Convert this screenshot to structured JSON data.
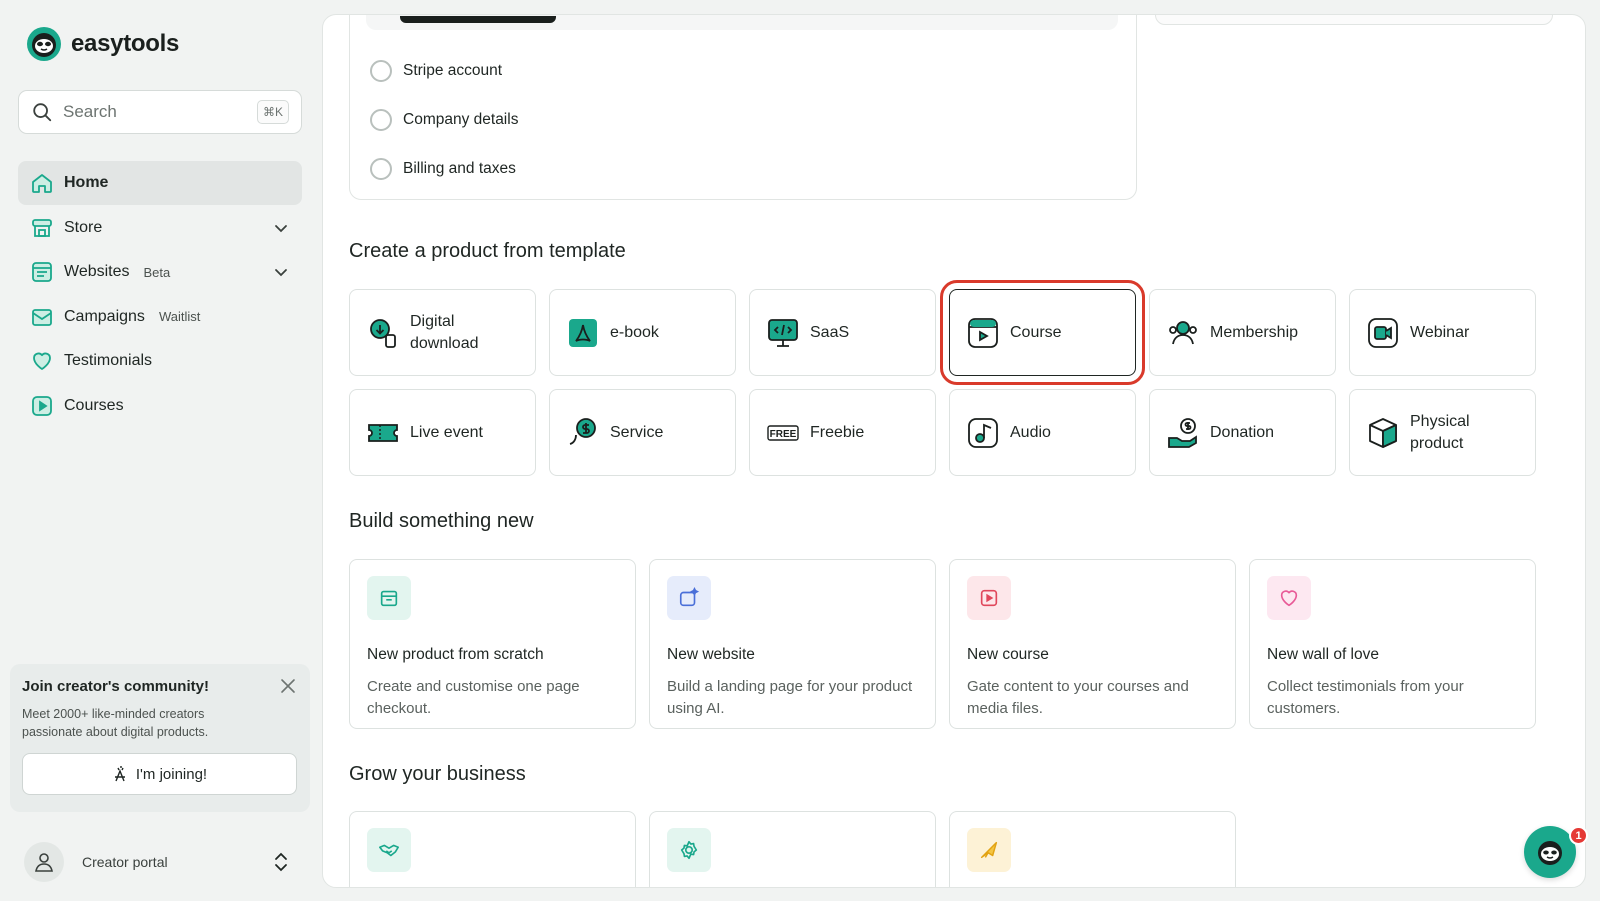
{
  "brand": {
    "name": "easytools"
  },
  "search": {
    "placeholder": "Search",
    "shortcut": "⌘K"
  },
  "sidebar": {
    "items": [
      {
        "label": "Home",
        "icon": "home-icon",
        "active": true
      },
      {
        "label": "Store",
        "icon": "store-icon",
        "expandable": true
      },
      {
        "label": "Websites",
        "tag": "Beta",
        "icon": "websites-icon",
        "expandable": true
      },
      {
        "label": "Campaigns",
        "tag": "Waitlist",
        "icon": "campaigns-icon"
      },
      {
        "label": "Testimonials",
        "icon": "heart-icon"
      },
      {
        "label": "Courses",
        "icon": "play-icon"
      }
    ]
  },
  "community": {
    "title": "Join creator's community!",
    "description": "Meet 2000+ like-minded creators passionate about digital products.",
    "button": "I'm joining!"
  },
  "portal": {
    "label": "Creator portal"
  },
  "checklist": {
    "items": [
      {
        "label": "Stripe account"
      },
      {
        "label": "Company details"
      },
      {
        "label": "Billing and taxes"
      }
    ]
  },
  "templates": {
    "title": "Create a product from template",
    "items": [
      {
        "label": "Digital download",
        "icon": "digital-download-icon"
      },
      {
        "label": "e-book",
        "icon": "ebook-icon"
      },
      {
        "label": "SaaS",
        "icon": "saas-icon"
      },
      {
        "label": "Course",
        "icon": "course-icon",
        "highlighted": true
      },
      {
        "label": "Membership",
        "icon": "membership-icon"
      },
      {
        "label": "Webinar",
        "icon": "webinar-icon"
      },
      {
        "label": "Live event",
        "icon": "ticket-icon"
      },
      {
        "label": "Service",
        "icon": "service-icon"
      },
      {
        "label": "Freebie",
        "icon": "free-icon"
      },
      {
        "label": "Audio",
        "icon": "audio-icon"
      },
      {
        "label": "Donation",
        "icon": "donation-icon"
      },
      {
        "label": "Physical product",
        "icon": "box-icon"
      }
    ]
  },
  "build": {
    "title": "Build something new",
    "items": [
      {
        "title": "New product from scratch",
        "description": "Create and customise one page checkout.",
        "icon": "store-icon",
        "bg": "#e3f5ef",
        "color": "#1aa88c"
      },
      {
        "title": "New website",
        "description": "Build a landing page for your product using AI.",
        "icon": "sparkle-window-icon",
        "bg": "#e6ecfb",
        "color": "#4a6fd8"
      },
      {
        "title": "New course",
        "description": "Gate content to your courses and media files.",
        "icon": "play-icon",
        "bg": "#fde7ea",
        "color": "#e0475b"
      },
      {
        "title": "New wall of love",
        "description": "Collect testimonials from your customers.",
        "icon": "heart-icon",
        "bg": "#fde8f1",
        "color": "#e85a97"
      }
    ]
  },
  "grow": {
    "title": "Grow your business",
    "items": [
      {
        "icon": "handshake-icon",
        "bg": "#e3f5ef",
        "color": "#1aa88c"
      },
      {
        "icon": "gear-icon",
        "bg": "#e3f5ef",
        "color": "#1aa88c"
      },
      {
        "icon": "send-icon",
        "bg": "#fdf2d6",
        "color": "#e2a313"
      }
    ]
  },
  "chat": {
    "badge": "1"
  },
  "colors": {
    "accent": "#1aa88c",
    "highlight": "#d93a2b"
  }
}
